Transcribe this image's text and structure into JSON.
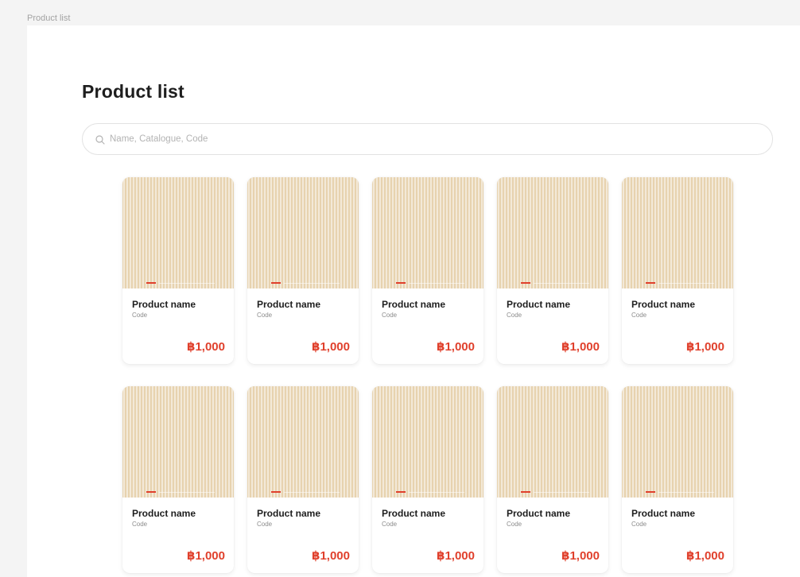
{
  "frame": {
    "label": "Product list"
  },
  "page": {
    "title": "Product list"
  },
  "search": {
    "placeholder": "Name, Catalogue, Code",
    "icon": "search-icon"
  },
  "colors": {
    "accent": "#e0402c",
    "image_bg": "#efe2cc",
    "title": "#1e1e1e"
  },
  "products": [
    {
      "name": "Product name",
      "code": "Code",
      "price": "฿1,000"
    },
    {
      "name": "Product name",
      "code": "Code",
      "price": "฿1,000"
    },
    {
      "name": "Product name",
      "code": "Code",
      "price": "฿1,000"
    },
    {
      "name": "Product name",
      "code": "Code",
      "price": "฿1,000"
    },
    {
      "name": "Product name",
      "code": "Code",
      "price": "฿1,000"
    },
    {
      "name": "Product name",
      "code": "Code",
      "price": "฿1,000"
    },
    {
      "name": "Product name",
      "code": "Code",
      "price": "฿1,000"
    },
    {
      "name": "Product name",
      "code": "Code",
      "price": "฿1,000"
    },
    {
      "name": "Product name",
      "code": "Code",
      "price": "฿1,000"
    },
    {
      "name": "Product name",
      "code": "Code",
      "price": "฿1,000"
    }
  ]
}
